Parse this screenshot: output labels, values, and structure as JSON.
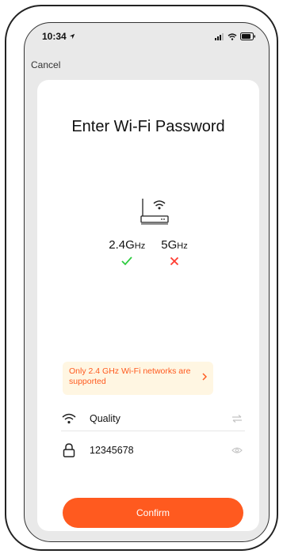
{
  "status_bar": {
    "time": "10:34"
  },
  "nav": {
    "cancel_label": "Cancel"
  },
  "page": {
    "title": "Enter Wi-Fi Password"
  },
  "bands": [
    {
      "main": "2.4G",
      "unit": "Hz",
      "supported": true
    },
    {
      "main": "5G",
      "unit": "Hz",
      "supported": false
    }
  ],
  "notice": {
    "text": "Only 2.4 GHz Wi-Fi networks are supported"
  },
  "form": {
    "ssid_value": "Quality",
    "password_value": "12345678"
  },
  "actions": {
    "confirm_label": "Confirm"
  },
  "colors": {
    "accent": "#ff5a1f",
    "success": "#2ecc40",
    "error": "#ff3b30",
    "notice_bg": "#fff6e2"
  }
}
